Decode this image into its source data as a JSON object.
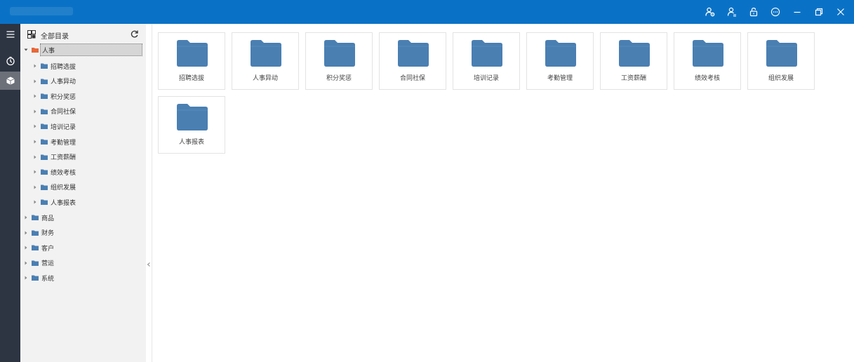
{
  "colors": {
    "brand": "#0a72c6",
    "rail": "#2d3442",
    "folder_blue": "#4a7fb2",
    "folder_orange": "#e8683a"
  },
  "titlebar": {
    "controls": [
      {
        "name": "user-settings-icon"
      },
      {
        "name": "user-switch-icon"
      },
      {
        "name": "lock-icon"
      },
      {
        "name": "more-icon"
      },
      {
        "name": "minimize-icon"
      },
      {
        "name": "restore-icon"
      },
      {
        "name": "close-icon"
      }
    ]
  },
  "rail": {
    "items": [
      {
        "name": "menu-icon"
      },
      {
        "name": "history-icon"
      },
      {
        "name": "cube-icon"
      }
    ]
  },
  "tree": {
    "header_label": "全部目录",
    "root": {
      "label": "人事",
      "children": [
        "招聘选拔",
        "人事异动",
        "积分奖惩",
        "合同社保",
        "培训记录",
        "考勤管理",
        "工资薪酬",
        "绩效考核",
        "组织发展",
        "人事报表"
      ]
    },
    "siblings": [
      "商品",
      "财务",
      "客户",
      "营运",
      "系统"
    ]
  },
  "folders": [
    "招聘选拔",
    "人事异动",
    "积分奖惩",
    "合同社保",
    "培训记录",
    "考勤管理",
    "工资薪酬",
    "绩效考核",
    "组织发展",
    "人事报表"
  ]
}
